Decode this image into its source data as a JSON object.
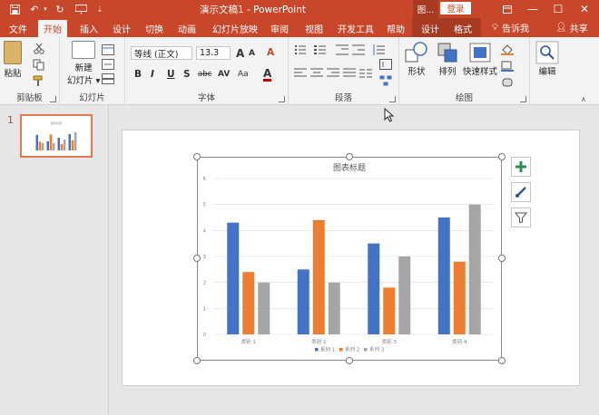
{
  "window": {
    "doc_title": "演示文稿1  -  PowerPoint",
    "context_label": "图...",
    "login_label": "登录",
    "min_glyph": "—",
    "max_glyph": "☐",
    "close_glyph": "✕"
  },
  "tabs": [
    {
      "label": "文件",
      "active": false
    },
    {
      "label": "开始",
      "active": true
    },
    {
      "label": "插入",
      "active": false
    },
    {
      "label": "设计",
      "active": false
    },
    {
      "label": "切换",
      "active": false
    },
    {
      "label": "动画",
      "active": false
    },
    {
      "label": "幻灯片放映",
      "active": false
    },
    {
      "label": "审阅",
      "active": false
    },
    {
      "label": "视图",
      "active": false
    },
    {
      "label": "开发工具",
      "active": false
    },
    {
      "label": "帮助",
      "active": false
    },
    {
      "label": "设计",
      "active": false
    },
    {
      "label": "格式",
      "active": false
    }
  ],
  "tell_me": "告诉我",
  "share": "共享",
  "ribbon": {
    "clipboard": {
      "label": "剪贴板",
      "paste": "粘贴"
    },
    "slides": {
      "label": "幻灯片",
      "new_slide_line1": "新建",
      "new_slide_line2": "幻灯片 ▾"
    },
    "font": {
      "label": "字体",
      "font_name": "等线 (正文)",
      "font_size": "13.3",
      "bold": "B",
      "italic": "I",
      "underline": "U",
      "strike": "S",
      "shadow": "abc",
      "spacing": "AV",
      "case": "Aa",
      "grow": "A",
      "shrink": "A",
      "clear": "A",
      "color": "A"
    },
    "paragraph": {
      "label": "段落"
    },
    "drawing": {
      "label": "绘图",
      "shape": "形状",
      "arrange": "排列",
      "quick_style": "快速样式"
    },
    "editing": {
      "label": "编辑"
    }
  },
  "thumbnail": {
    "number": "1"
  },
  "colors": {
    "accent": "#c8472a",
    "series1": "#4472c4",
    "series2": "#ed7d31",
    "series3": "#a5a5a5"
  },
  "icons": {
    "add_element": "plus-icon",
    "style": "brush-icon",
    "filter": "filter-icon"
  },
  "chart_data": {
    "type": "bar",
    "title": "图表标题",
    "categories": [
      "类别 1",
      "类别 2",
      "类别 3",
      "类别 4"
    ],
    "series": [
      {
        "name": "系列 1",
        "values": [
          4.3,
          2.5,
          3.5,
          4.5
        ]
      },
      {
        "name": "系列 2",
        "values": [
          2.4,
          4.4,
          1.8,
          2.8
        ]
      },
      {
        "name": "系列 3",
        "values": [
          2.0,
          2.0,
          3.0,
          5.0
        ]
      }
    ],
    "ylim": [
      0,
      6
    ],
    "yticks": [
      "0",
      "1",
      "2",
      "3",
      "4",
      "5",
      "6"
    ],
    "grid": true,
    "legend": "bottom"
  }
}
